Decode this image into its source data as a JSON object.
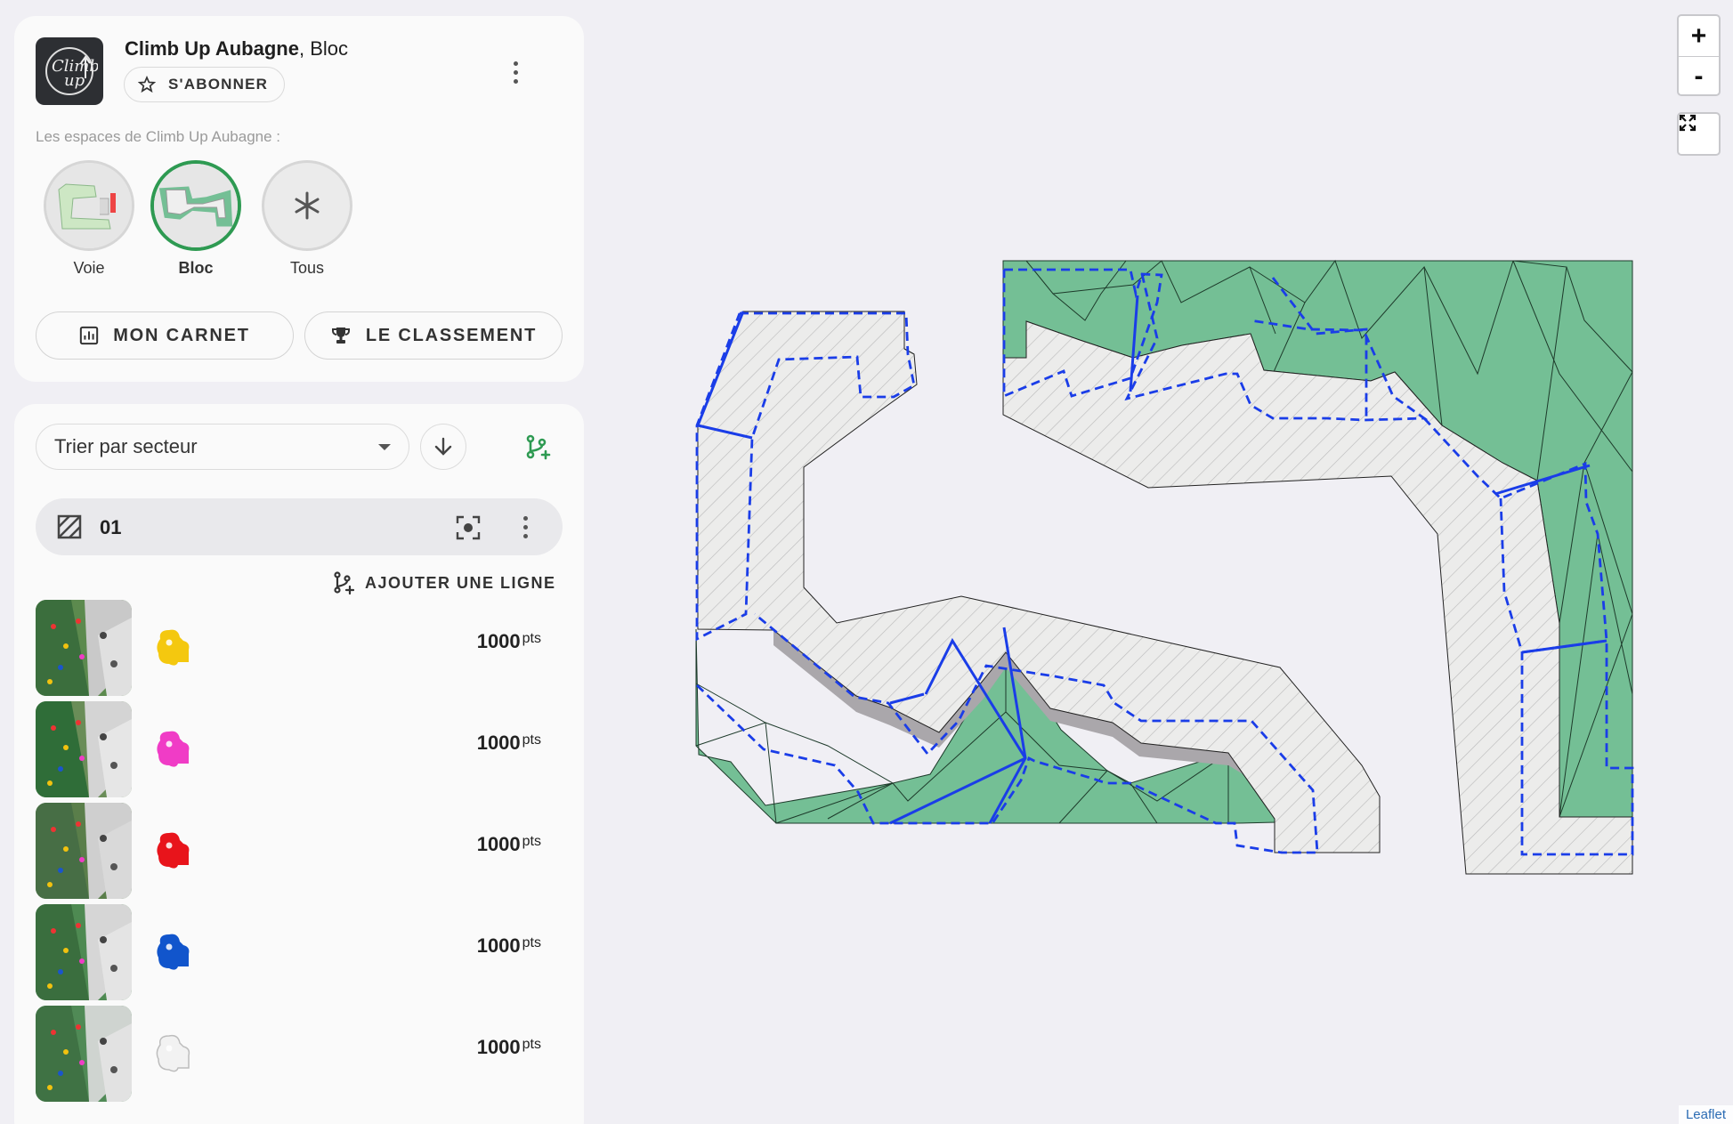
{
  "gym": {
    "name": "Climb Up Aubagne",
    "space": ", Bloc",
    "logo_text_1": "Climb",
    "logo_text_2": "up"
  },
  "header": {
    "subscribe_label": "S'ABONNER",
    "spaces_label": "Les espaces de Climb Up Aubagne :"
  },
  "spaces": [
    {
      "label": "Voie",
      "active": false
    },
    {
      "label": "Bloc",
      "active": true
    },
    {
      "label": "Tous",
      "active": false
    }
  ],
  "actions": {
    "carnet_label": "MON CARNET",
    "classement_label": "LE CLASSEMENT"
  },
  "list": {
    "sort_label": "Trier par secteur",
    "sector_name": "01",
    "add_line_label": "AJOUTER UNE LIGNE",
    "routes": [
      {
        "hold_color": "#f4c80f",
        "points": "1000",
        "unit": "pts"
      },
      {
        "hold_color": "#f03cc6",
        "points": "1000",
        "unit": "pts"
      },
      {
        "hold_color": "#e8141b",
        "points": "1000",
        "unit": "pts"
      },
      {
        "hold_color": "#1155cc",
        "points": "1000",
        "unit": "pts"
      },
      {
        "hold_color": "#f2f2f2",
        "points": "1000",
        "unit": "pts"
      }
    ]
  },
  "map": {
    "zoom_in_label": "+",
    "zoom_out_label": "-",
    "attribution": "Leaflet",
    "colors": {
      "mat": "#74bf95",
      "wall": "#eaeaea",
      "line": "#1a3de8"
    }
  }
}
